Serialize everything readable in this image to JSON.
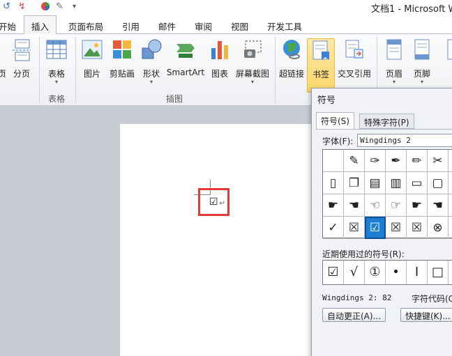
{
  "window": {
    "title": "文档1 - Microsoft W",
    "quick_access": [
      "undo-icon",
      "redo-icon",
      "color-icon",
      "format-painter-icon",
      "customize-icon"
    ]
  },
  "tabs": [
    {
      "label": "开始"
    },
    {
      "label": "插入",
      "active": true
    },
    {
      "label": "页面布局"
    },
    {
      "label": "引用"
    },
    {
      "label": "邮件"
    },
    {
      "label": "审阅"
    },
    {
      "label": "视图"
    },
    {
      "label": "开发工具"
    }
  ],
  "ribbon": {
    "buttons": {
      "page": "页",
      "page_break": "分页",
      "table": "表格",
      "picture": "图片",
      "clip_art": "剪贴画",
      "shapes": "形状",
      "smartart": "SmartArt",
      "chart": "图表",
      "screenshot": "屏幕截图",
      "hyperlink": "超链接",
      "bookmark": "书签",
      "cross_reference": "交叉引用",
      "header": "页眉",
      "footer": "页脚"
    },
    "dropdown_arrow": "▾",
    "groups": {
      "tables": "表格",
      "illustrations": "插图"
    }
  },
  "document": {
    "inserted_symbol": "☑",
    "paragraph_mark": "↵"
  },
  "symbol_dialog": {
    "title": "符号",
    "tabs": [
      "符号(S)",
      "特殊字符(P)"
    ],
    "font_label": "字体(F):",
    "font_value": "Wingdings 2",
    "grid": [
      [
        "",
        "✎",
        "✑",
        "✒",
        "✏",
        "✂",
        ""
      ],
      [
        "▯",
        "❐",
        "▤",
        "▥",
        "▭",
        "▢",
        ""
      ],
      [
        "☛",
        "☚",
        "☜",
        "☞",
        "☛",
        "☚",
        ""
      ],
      [
        "✓",
        "☒",
        "☑",
        "☒",
        "☒",
        "⊗",
        ""
      ]
    ],
    "selected_cell": [
      3,
      2
    ],
    "recent_label": "近期使用过的符号(R):",
    "recent_symbols": [
      "☑",
      "√",
      "①",
      "•",
      "I",
      "□",
      ""
    ],
    "font_info": "Wingdings 2: 82",
    "char_code_label": "字符代码(C",
    "buttons": {
      "autocorrect": "自动更正(A)...",
      "shortcut": "快捷键(K)..."
    },
    "selection_color": "#1b7fd4"
  },
  "colors": {
    "highlight_box": "#e23a3a",
    "bookmark_highlight": "#fbd76a"
  }
}
